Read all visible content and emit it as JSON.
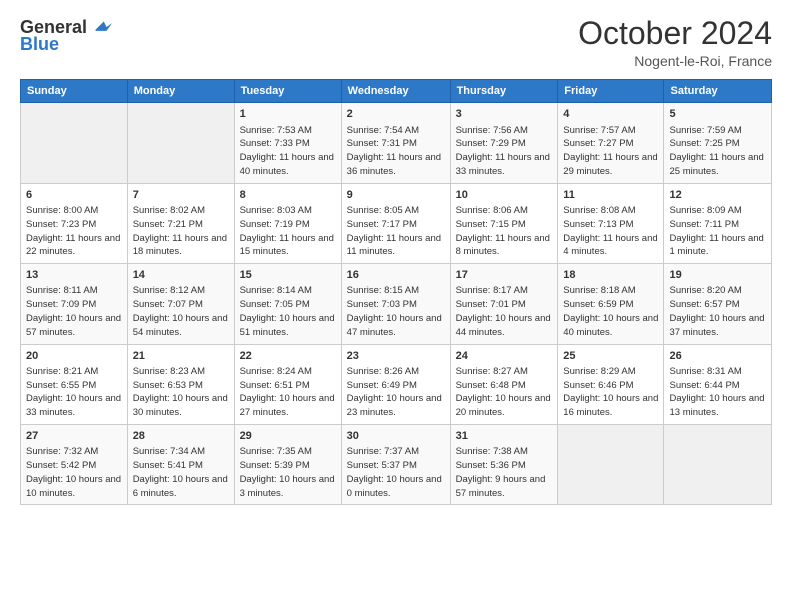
{
  "header": {
    "logo_line1": "General",
    "logo_line2": "Blue",
    "month": "October 2024",
    "location": "Nogent-le-Roi, France"
  },
  "weekdays": [
    "Sunday",
    "Monday",
    "Tuesday",
    "Wednesday",
    "Thursday",
    "Friday",
    "Saturday"
  ],
  "weeks": [
    [
      {
        "day": "",
        "empty": true
      },
      {
        "day": "",
        "empty": true
      },
      {
        "day": "1",
        "sunrise": "7:53 AM",
        "sunset": "7:33 PM",
        "daylight": "11 hours and 40 minutes."
      },
      {
        "day": "2",
        "sunrise": "7:54 AM",
        "sunset": "7:31 PM",
        "daylight": "11 hours and 36 minutes."
      },
      {
        "day": "3",
        "sunrise": "7:56 AM",
        "sunset": "7:29 PM",
        "daylight": "11 hours and 33 minutes."
      },
      {
        "day": "4",
        "sunrise": "7:57 AM",
        "sunset": "7:27 PM",
        "daylight": "11 hours and 29 minutes."
      },
      {
        "day": "5",
        "sunrise": "7:59 AM",
        "sunset": "7:25 PM",
        "daylight": "11 hours and 25 minutes."
      }
    ],
    [
      {
        "day": "6",
        "sunrise": "8:00 AM",
        "sunset": "7:23 PM",
        "daylight": "11 hours and 22 minutes."
      },
      {
        "day": "7",
        "sunrise": "8:02 AM",
        "sunset": "7:21 PM",
        "daylight": "11 hours and 18 minutes."
      },
      {
        "day": "8",
        "sunrise": "8:03 AM",
        "sunset": "7:19 PM",
        "daylight": "11 hours and 15 minutes."
      },
      {
        "day": "9",
        "sunrise": "8:05 AM",
        "sunset": "7:17 PM",
        "daylight": "11 hours and 11 minutes."
      },
      {
        "day": "10",
        "sunrise": "8:06 AM",
        "sunset": "7:15 PM",
        "daylight": "11 hours and 8 minutes."
      },
      {
        "day": "11",
        "sunrise": "8:08 AM",
        "sunset": "7:13 PM",
        "daylight": "11 hours and 4 minutes."
      },
      {
        "day": "12",
        "sunrise": "8:09 AM",
        "sunset": "7:11 PM",
        "daylight": "11 hours and 1 minute."
      }
    ],
    [
      {
        "day": "13",
        "sunrise": "8:11 AM",
        "sunset": "7:09 PM",
        "daylight": "10 hours and 57 minutes."
      },
      {
        "day": "14",
        "sunrise": "8:12 AM",
        "sunset": "7:07 PM",
        "daylight": "10 hours and 54 minutes."
      },
      {
        "day": "15",
        "sunrise": "8:14 AM",
        "sunset": "7:05 PM",
        "daylight": "10 hours and 51 minutes."
      },
      {
        "day": "16",
        "sunrise": "8:15 AM",
        "sunset": "7:03 PM",
        "daylight": "10 hours and 47 minutes."
      },
      {
        "day": "17",
        "sunrise": "8:17 AM",
        "sunset": "7:01 PM",
        "daylight": "10 hours and 44 minutes."
      },
      {
        "day": "18",
        "sunrise": "8:18 AM",
        "sunset": "6:59 PM",
        "daylight": "10 hours and 40 minutes."
      },
      {
        "day": "19",
        "sunrise": "8:20 AM",
        "sunset": "6:57 PM",
        "daylight": "10 hours and 37 minutes."
      }
    ],
    [
      {
        "day": "20",
        "sunrise": "8:21 AM",
        "sunset": "6:55 PM",
        "daylight": "10 hours and 33 minutes."
      },
      {
        "day": "21",
        "sunrise": "8:23 AM",
        "sunset": "6:53 PM",
        "daylight": "10 hours and 30 minutes."
      },
      {
        "day": "22",
        "sunrise": "8:24 AM",
        "sunset": "6:51 PM",
        "daylight": "10 hours and 27 minutes."
      },
      {
        "day": "23",
        "sunrise": "8:26 AM",
        "sunset": "6:49 PM",
        "daylight": "10 hours and 23 minutes."
      },
      {
        "day": "24",
        "sunrise": "8:27 AM",
        "sunset": "6:48 PM",
        "daylight": "10 hours and 20 minutes."
      },
      {
        "day": "25",
        "sunrise": "8:29 AM",
        "sunset": "6:46 PM",
        "daylight": "10 hours and 16 minutes."
      },
      {
        "day": "26",
        "sunrise": "8:31 AM",
        "sunset": "6:44 PM",
        "daylight": "10 hours and 13 minutes."
      }
    ],
    [
      {
        "day": "27",
        "sunrise": "7:32 AM",
        "sunset": "5:42 PM",
        "daylight": "10 hours and 10 minutes."
      },
      {
        "day": "28",
        "sunrise": "7:34 AM",
        "sunset": "5:41 PM",
        "daylight": "10 hours and 6 minutes."
      },
      {
        "day": "29",
        "sunrise": "7:35 AM",
        "sunset": "5:39 PM",
        "daylight": "10 hours and 3 minutes."
      },
      {
        "day": "30",
        "sunrise": "7:37 AM",
        "sunset": "5:37 PM",
        "daylight": "10 hours and 0 minutes."
      },
      {
        "day": "31",
        "sunrise": "7:38 AM",
        "sunset": "5:36 PM",
        "daylight": "9 hours and 57 minutes."
      },
      {
        "day": "",
        "empty": true
      },
      {
        "day": "",
        "empty": true
      }
    ]
  ]
}
